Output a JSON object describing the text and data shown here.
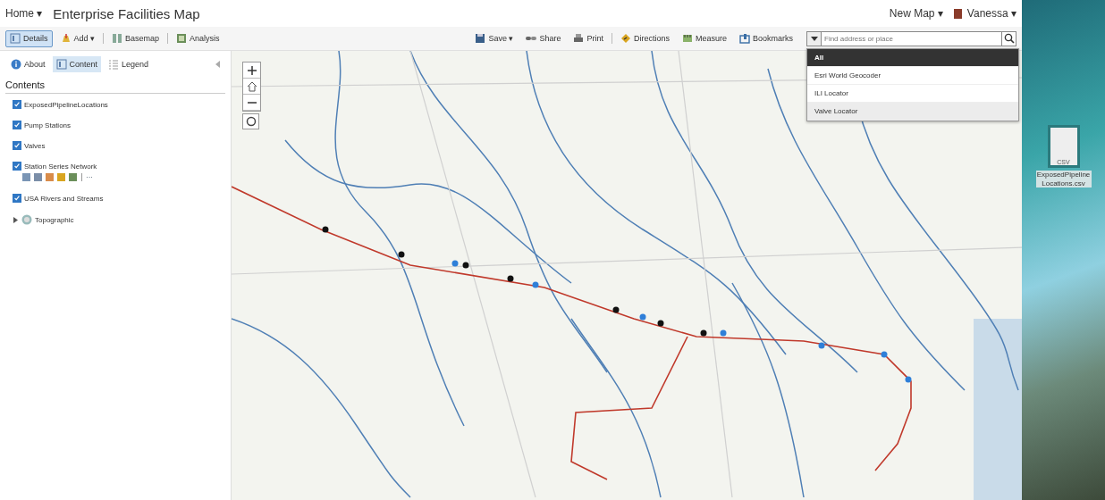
{
  "header": {
    "home": "Home",
    "home_caret": "▾",
    "title": "Enterprise Facilities Map",
    "new_map": "New Map",
    "new_map_caret": "▾",
    "user": "Vanessa",
    "user_caret": "▾"
  },
  "toolbar_left": [
    {
      "kind": "toggle",
      "label": "Details",
      "selected": true
    },
    {
      "kind": "menu",
      "label": "Add",
      "caret": "▾",
      "selected": false
    },
    {
      "kind": "plain",
      "label": "Basemap",
      "selected": false
    },
    {
      "kind": "plain",
      "label": "Analysis",
      "selected": false
    }
  ],
  "toolbar_right": [
    {
      "kind": "menu",
      "label": "Save",
      "caret": "▾"
    },
    {
      "kind": "plain",
      "label": "Share"
    },
    {
      "kind": "plain",
      "label": "Print"
    },
    {
      "kind": "plain",
      "label": "Directions"
    },
    {
      "kind": "plain",
      "label": "Measure"
    },
    {
      "kind": "plain",
      "label": "Bookmarks"
    }
  ],
  "search": {
    "placeholder": "Find address or place",
    "options": [
      {
        "label": "All",
        "selected": true,
        "hover": false
      },
      {
        "label": "Esri World Geocoder",
        "selected": false,
        "hover": false
      },
      {
        "label": "ILI Locator",
        "selected": false,
        "hover": false
      },
      {
        "label": "Valve Locator",
        "selected": false,
        "hover": true
      }
    ]
  },
  "panel_tabs": [
    {
      "label": "About",
      "selected": false
    },
    {
      "label": "Content",
      "selected": true
    },
    {
      "label": "Legend",
      "selected": false
    }
  ],
  "contents_heading": "Contents",
  "layers": [
    {
      "kind": "check",
      "label": "ExposedPipelineLocations",
      "checked": true,
      "tools": false
    },
    {
      "kind": "check",
      "label": "Pump Stations",
      "checked": true,
      "tools": false
    },
    {
      "kind": "check",
      "label": "Valves",
      "checked": true,
      "tools": false
    },
    {
      "kind": "check",
      "label": "Station Series Network",
      "checked": true,
      "tools": true,
      "more": "···"
    },
    {
      "kind": "check",
      "label": "USA Rivers and Streams",
      "checked": true,
      "tools": false
    },
    {
      "kind": "basemap",
      "label": "Topographic",
      "expanded": false
    }
  ],
  "desktop": {
    "file_label": "ExposedPipelineLocations.csv",
    "file_type": "CSV"
  }
}
